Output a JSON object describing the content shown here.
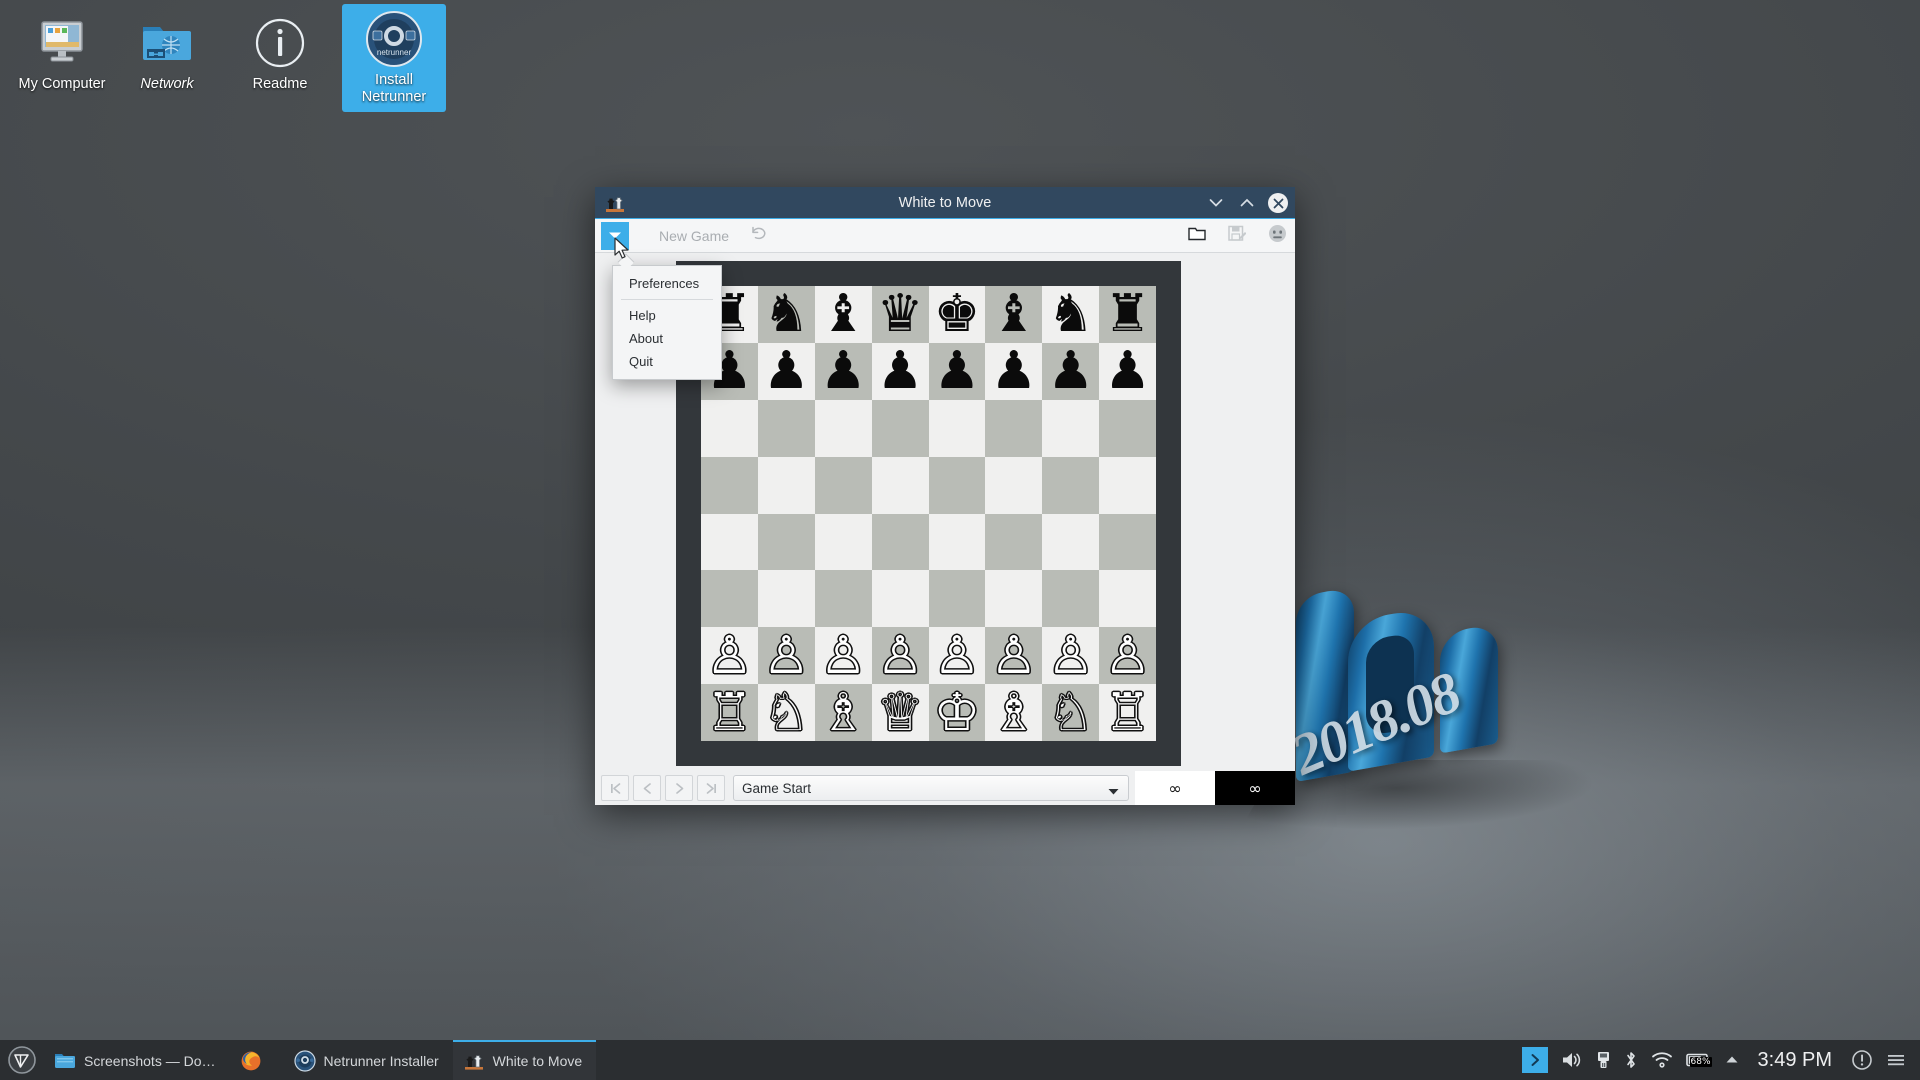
{
  "desktop": {
    "icons": [
      {
        "label": "My Computer",
        "icon": "computer-icon",
        "selected": false,
        "italic": false
      },
      {
        "label": "Network",
        "icon": "network-folder-icon",
        "selected": false,
        "italic": true
      },
      {
        "label": "Readme",
        "icon": "info-icon",
        "selected": false,
        "italic": false
      },
      {
        "label": "Install\nNetrunner",
        "label_line1": "Install",
        "label_line2": "Netrunner",
        "icon": "netrunner-disc-icon",
        "selected": true,
        "italic": false
      }
    ],
    "wallpaper_year": "2018.08"
  },
  "window": {
    "title": "White to Move",
    "titlebar_icon": "chess-pieces-icon",
    "buttons": {
      "minimize": "chevron-down-icon",
      "maximize": "chevron-up-icon",
      "close": "close-icon"
    },
    "toolbar": {
      "menu_button": "chevron-down-icon",
      "new_game_label": "New Game",
      "undo_icon": "undo-arrow-icon",
      "open_icon": "open-folder-icon",
      "save_icon": "save-disk-icon",
      "face_icon": "neutral-face-icon"
    },
    "menu": {
      "items": [
        {
          "label": "Preferences",
          "separator_after": true
        },
        {
          "label": "Help",
          "separator_after": false
        },
        {
          "label": "About",
          "separator_after": false
        },
        {
          "label": "Quit",
          "separator_after": false
        }
      ]
    },
    "bottombar": {
      "nav_first": "first-move-icon",
      "nav_prev": "previous-move-icon",
      "nav_next": "next-move-icon",
      "nav_last": "last-move-icon",
      "move_selected": "Game Start",
      "move_dropdown_arrow": "chevron-down-icon",
      "clock_white": "∞",
      "clock_black": "∞"
    }
  },
  "chess_board": {
    "light_square_color": "#f0f0ef",
    "dark_square_color": "#b9bcb6",
    "border_color": "#33373b",
    "orientation": "white-bottom",
    "rows": [
      [
        "bR",
        "bN",
        "bB",
        "bQ",
        "bK",
        "bB",
        "bN",
        "bR"
      ],
      [
        "bP",
        "bP",
        "bP",
        "bP",
        "bP",
        "bP",
        "bP",
        "bP"
      ],
      [
        "",
        "",
        "",
        "",
        "",
        "",
        "",
        ""
      ],
      [
        "",
        "",
        "",
        "",
        "",
        "",
        "",
        ""
      ],
      [
        "",
        "",
        "",
        "",
        "",
        "",
        "",
        ""
      ],
      [
        "",
        "",
        "",
        "",
        "",
        "",
        "",
        ""
      ],
      [
        "wP",
        "wP",
        "wP",
        "wP",
        "wP",
        "wP",
        "wP",
        "wP"
      ],
      [
        "wR",
        "wN",
        "wB",
        "wQ",
        "wK",
        "wB",
        "wN",
        "wR"
      ]
    ],
    "glyphs": {
      "wK": "♔",
      "wQ": "♕",
      "wR": "♖",
      "wB": "♗",
      "wN": "♘",
      "wP": "♙",
      "bK": "♚",
      "bQ": "♛",
      "bR": "♜",
      "bB": "♝",
      "bN": "♞",
      "bP": "♟"
    }
  },
  "taskbar": {
    "launcher_icon": "kde-launcher-icon",
    "tasks": [
      {
        "label": "Screenshots — Do…",
        "icon": "folder-icon",
        "active": false
      },
      {
        "label": "",
        "icon": "firefox-icon",
        "active": false
      },
      {
        "label": "Netrunner Installer",
        "icon": "netrunner-icon",
        "active": false
      },
      {
        "label": "White to Move",
        "icon": "chess-pieces-icon",
        "active": true
      }
    ],
    "tray": [
      {
        "name": "tray-expand-icon",
        "glyph": "›"
      },
      {
        "name": "volume-icon"
      },
      {
        "name": "usb-icon"
      },
      {
        "name": "bluetooth-icon"
      },
      {
        "name": "wifi-icon"
      },
      {
        "name": "battery-icon",
        "battery_percent": "68%"
      },
      {
        "name": "show-hidden-icon"
      }
    ],
    "clock": "3:49 PM",
    "notification_icon": "notification-icon",
    "menu_icon": "hamburger-icon"
  },
  "colors": {
    "accent": "#3daee9",
    "titlebar": "#31485f",
    "panel": "#2b2e31",
    "window_bg": "#eff0f1"
  }
}
